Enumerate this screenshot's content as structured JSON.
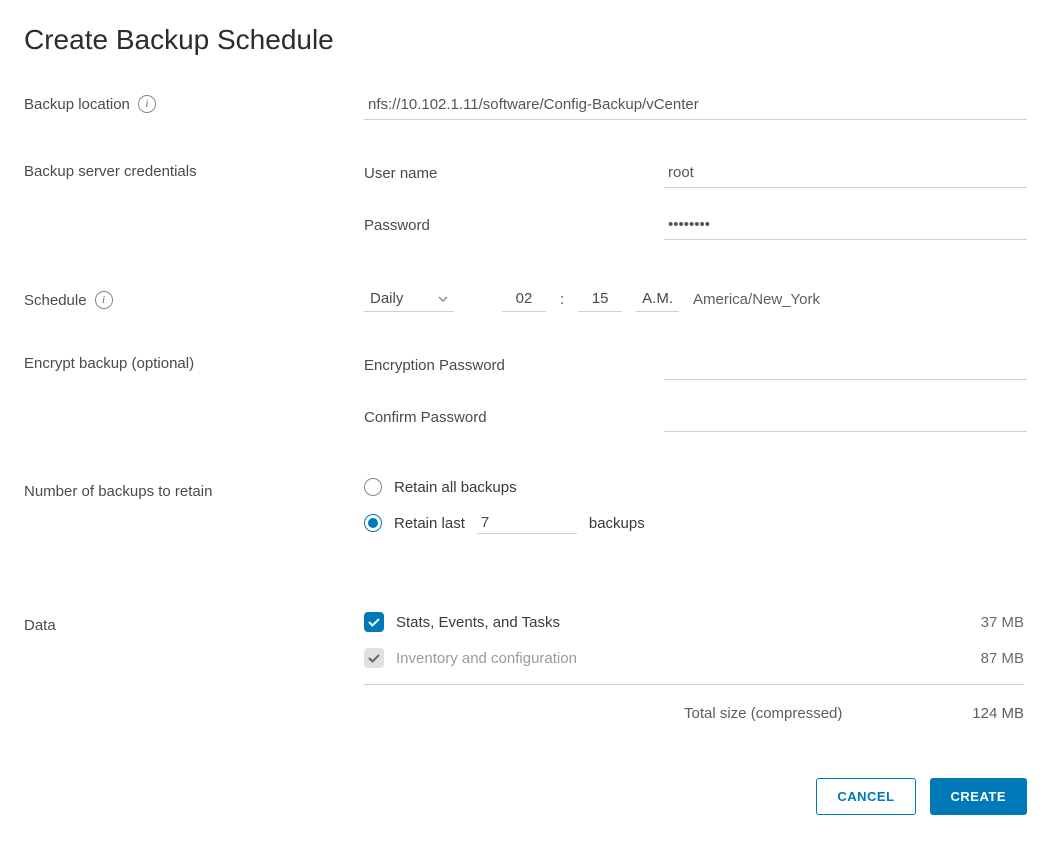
{
  "title": "Create Backup Schedule",
  "backup_location": {
    "label": "Backup location",
    "value": "nfs://10.102.1.11/software/Config-Backup/vCenter"
  },
  "credentials": {
    "label": "Backup server credentials",
    "username_label": "User name",
    "username_value": "root",
    "password_label": "Password",
    "password_value": "••••••••"
  },
  "schedule": {
    "label": "Schedule",
    "frequency": "Daily",
    "hour": "02",
    "minute": "15",
    "ampm": "A.M.",
    "timezone": "America/New_York"
  },
  "encrypt": {
    "label": "Encrypt backup (optional)",
    "password_label": "Encryption Password",
    "confirm_label": "Confirm Password",
    "password_value": "",
    "confirm_value": ""
  },
  "retain": {
    "label": "Number of backups to retain",
    "option_all": "Retain all backups",
    "option_last_prefix": "Retain last",
    "option_last_value": "7",
    "option_last_suffix": "backups"
  },
  "data": {
    "label": "Data",
    "items": [
      {
        "label": "Stats, Events, and Tasks",
        "size": "37 MB",
        "checked": true,
        "disabled": false
      },
      {
        "label": "Inventory and configuration",
        "size": "87 MB",
        "checked": true,
        "disabled": true
      }
    ],
    "total_label": "Total size (compressed)",
    "total_value": "124 MB"
  },
  "footer": {
    "cancel": "CANCEL",
    "create": "CREATE"
  }
}
